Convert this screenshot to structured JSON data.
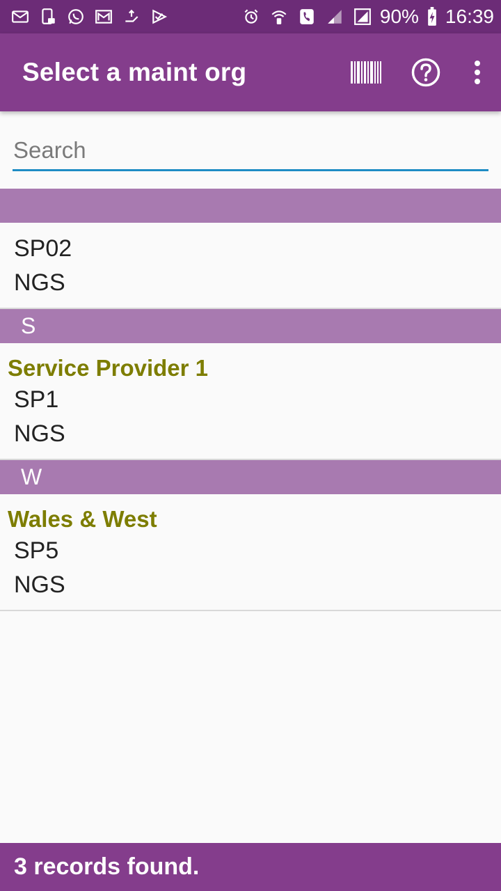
{
  "status_bar": {
    "battery": "90%",
    "time": "16:39",
    "left_icons": [
      "mail-icon",
      "phone-message-icon",
      "whatsapp-icon",
      "gmail-icon",
      "transfer-icon",
      "checkmark-app-icon"
    ],
    "right_icons": [
      "alarm-icon",
      "wifi-call-icon",
      "phone-icon",
      "signal-icon",
      "signal-full-icon",
      "battery-charging-icon"
    ]
  },
  "app_bar": {
    "title": "Select a maint org",
    "actions": [
      "barcode-icon",
      "help-icon",
      "more-vert-icon"
    ]
  },
  "search": {
    "placeholder": "Search",
    "value": ""
  },
  "sections": [
    {
      "header": "",
      "items": [
        {
          "name": "",
          "lines": [
            "SP02",
            "NGS"
          ]
        }
      ]
    },
    {
      "header": "S",
      "items": [
        {
          "name": "Service Provider 1",
          "lines": [
            "SP1",
            "NGS"
          ]
        }
      ]
    },
    {
      "header": "W",
      "items": [
        {
          "name": "Wales & West",
          "lines": [
            "SP5",
            "NGS"
          ]
        }
      ]
    }
  ],
  "footer": {
    "text": "3 records found."
  },
  "colors": {
    "status_bar": "#6c2c77",
    "app_bar": "#843d8c",
    "section_header": "#a87ab0",
    "org_name": "#7d7d00",
    "search_underline": "#1e8cc4"
  }
}
